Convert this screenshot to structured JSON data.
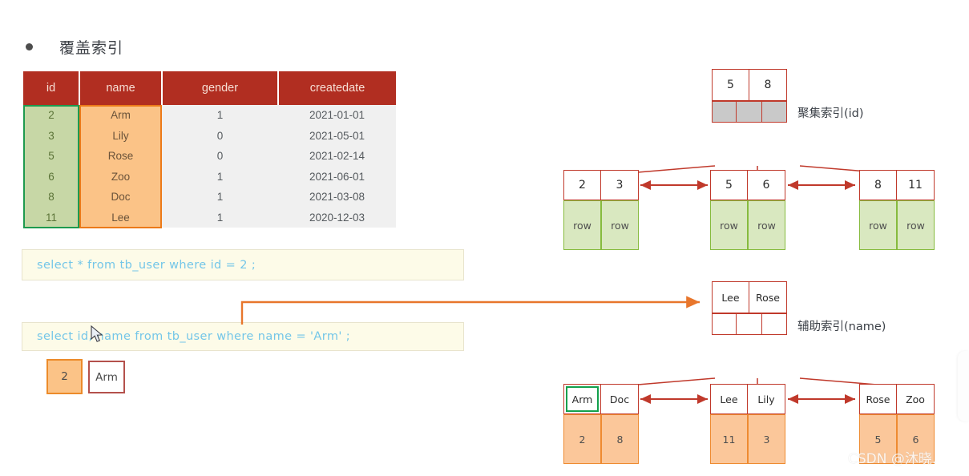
{
  "heading": {
    "bullet_icon": "bullet-dot",
    "text": "覆盖索引"
  },
  "data_table": {
    "columns": [
      "id",
      "name",
      "gender",
      "createdate"
    ],
    "rows": [
      [
        "2",
        "Arm",
        "1",
        "2021-01-01"
      ],
      [
        "3",
        "Lily",
        "0",
        "2021-05-01"
      ],
      [
        "5",
        "Rose",
        "0",
        "2021-02-14"
      ],
      [
        "6",
        "Zoo",
        "1",
        "2021-06-01"
      ],
      [
        "8",
        "Doc",
        "1",
        "2021-03-08"
      ],
      [
        "11",
        "Lee",
        "1",
        "2020-12-03"
      ]
    ],
    "highlight_columns": [
      "id",
      "name"
    ],
    "colors": {
      "header_bg": "#b12e21",
      "header_text": "#f6ded4",
      "body_bg": "#f0f0f0",
      "id_col_bg": "#c7d7a6",
      "id_col_outline": "#1e9a4f",
      "name_col_bg": "#fbc387",
      "name_col_outline": "#ec7a19"
    }
  },
  "sql_queries": [
    {
      "text": "select * from tb_user where id = 2 ;"
    },
    {
      "text": "select id, name from tb_user where name = 'Arm' ;"
    }
  ],
  "result_chips": [
    {
      "label": "2",
      "bg": "#fbc387",
      "border": "#ec8b2a"
    },
    {
      "label": "Arm",
      "bg": "#ffffff",
      "border": "#b4514c"
    }
  ],
  "clustered_index": {
    "label": "聚集索引(id)",
    "root": {
      "keys": [
        "5",
        "8"
      ],
      "pointer_cells": 3,
      "pointer_fill": "#c9c9c9"
    },
    "leaves": [
      {
        "keys": [
          "2",
          "3"
        ],
        "data": [
          "row",
          "row"
        ]
      },
      {
        "keys": [
          "5",
          "6"
        ],
        "data": [
          "row",
          "row"
        ]
      },
      {
        "keys": [
          "8",
          "11"
        ],
        "data": [
          "row",
          "row"
        ]
      }
    ],
    "leaf_data_color": "#d9e8c0",
    "leaf_data_border": "#86bb3e"
  },
  "secondary_index": {
    "label": "辅助索引(name)",
    "root": {
      "keys": [
        "Lee",
        "Rose"
      ],
      "pointer_cells": 3,
      "pointer_fill": "#ffffff"
    },
    "leaves": [
      {
        "keys": [
          "Arm",
          "Doc"
        ],
        "data": [
          "2",
          "8"
        ],
        "highlighted_key": "Arm"
      },
      {
        "keys": [
          "Lee",
          "Lily"
        ],
        "data": [
          "11",
          "3"
        ]
      },
      {
        "keys": [
          "Rose",
          "Zoo"
        ],
        "data": [
          "5",
          "6"
        ]
      }
    ],
    "leaf_data_color": "#fbc79a",
    "leaf_data_border": "#ee8b31",
    "highlight_outline": "#12a04c"
  },
  "connector": {
    "color": "#e8762c",
    "from": "sql-query-2",
    "to": "secondary-index-root"
  },
  "watermark": {
    "text": "CSDN @沐晓."
  },
  "cursor": {
    "icon": "mouse-pointer"
  }
}
